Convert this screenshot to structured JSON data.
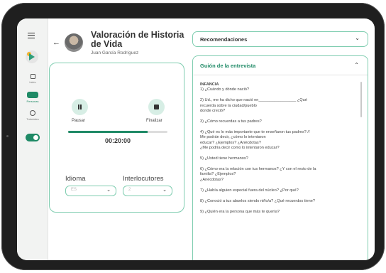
{
  "header": {
    "title": "Valoración de Historia de Vida",
    "subtitle": "Juan García Rodríguez"
  },
  "sidebar": {
    "items": [
      {
        "label": "Inicio",
        "icon": "grid-icon"
      },
      {
        "label": "Personas",
        "icon": "people-icon"
      },
      {
        "label": "Tutoriales",
        "icon": "tutorial-icon"
      }
    ]
  },
  "recorder": {
    "pause_label": "Pausar",
    "stop_label": "Finalizar",
    "timer": "00:20:00",
    "progress": 0.8,
    "language_label": "Idioma",
    "language_value": "ES",
    "speakers_label": "Interlocutores",
    "speakers_value": "2"
  },
  "recommendations": {
    "label": "Recomendaciones"
  },
  "guide": {
    "title": "Guión de la entrevista",
    "heading": "INFANCIA",
    "questions": [
      "1) ¿Cuándo y dónde nació?",
      "2) Ud., me ha dicho que nació en_________________ ¿Qué\nrecuerda sobre la ciudad/pueblo\ndonde creció?",
      "3) ¿Cómo recuerdas a tus padres?",
      "4) ¿Qué es lo más importante que te enseñaron tus padres? //\nMe podrán decir, ¿cómo lo intentaron\neducar? ¿Ejemplos? ¿Anécdotas?\n¿Me podría decir como lo intentaron educar?",
      "5) ¿Usted tiene hermanos?",
      "6) ¿Cómo era la relación con tus hermanos? ¿Y con el resto de la\nfamilia? ¿Ejemplos?\n¿Anécdotas?",
      "7) ¿Había alguien especial fuera del núcleo? ¿Por qué?",
      "8) ¿Conoció a tus abuelos siendo niño/a? ¿Qué recuerdos tiene?",
      "9) ¿Quién era la persona que más te quería?"
    ]
  },
  "colors": {
    "accent": "#1f8a66",
    "border": "#7fcdb0"
  }
}
